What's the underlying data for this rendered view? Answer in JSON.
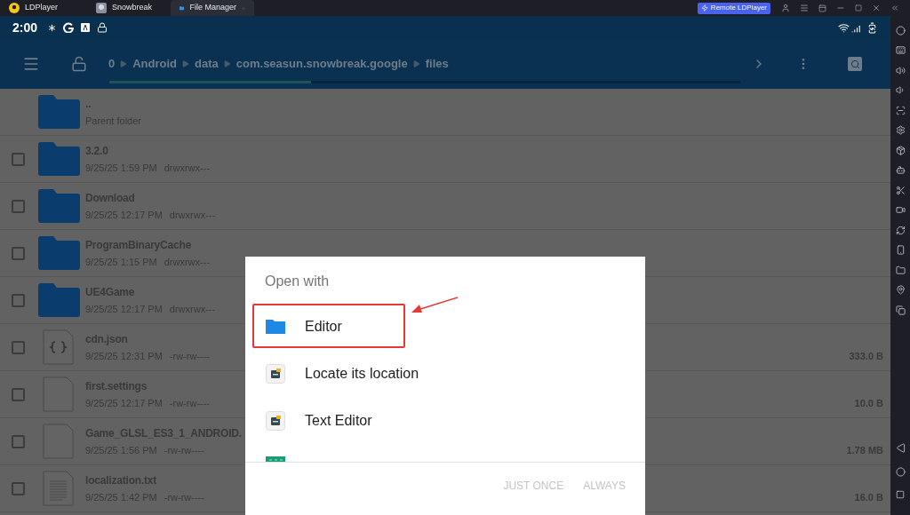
{
  "tabs": [
    {
      "label": "LDPlayer",
      "kind": "logo",
      "selected": false
    },
    {
      "label": "Snowbreak",
      "kind": "game",
      "selected": false
    },
    {
      "label": "File Manager",
      "kind": "folder",
      "selected": true
    }
  ],
  "remote_button": "Remote LDPlayer",
  "status_bar": {
    "time": "2:00"
  },
  "breadcrumbs": [
    "0",
    "Android",
    "data",
    "com.seasun.snowbreak.google",
    "files"
  ],
  "path_scroll": {
    "level": 0.32
  },
  "files": [
    {
      "kind": "parent",
      "name": "..",
      "meta": "Parent folder"
    },
    {
      "kind": "folder",
      "name": "3.2.0",
      "date": "9/25/25 1:59 PM",
      "perms": "drwxrwx---",
      "checked": false
    },
    {
      "kind": "folder",
      "name": "Download",
      "date": "9/25/25 12:17 PM",
      "perms": "drwxrwx---",
      "checked": false
    },
    {
      "kind": "folder",
      "name": "ProgramBinaryCache",
      "date": "9/25/25 1:15 PM",
      "perms": "drwxrwx---",
      "checked": false
    },
    {
      "kind": "folder",
      "name": "UE4Game",
      "date": "9/25/25 12:17 PM",
      "perms": "drwxrwx---",
      "checked": false
    },
    {
      "kind": "json",
      "name": "cdn.json",
      "date": "9/25/25 12:31 PM",
      "perms": "-rw-rw----",
      "size": "333.0 B",
      "checked": false
    },
    {
      "kind": "file",
      "name": "first.settings",
      "date": "9/25/25 12:17 PM",
      "perms": "-rw-rw----",
      "size": "10.0 B",
      "checked": false
    },
    {
      "kind": "file",
      "name": "Game_GLSL_ES3_1_ANDROID.",
      "date": "9/25/25 1:56 PM",
      "perms": "-rw-rw----",
      "size": "1.78 MB",
      "checked": false
    },
    {
      "kind": "text",
      "name": "localization.txt",
      "date": "9/25/25 1:42 PM",
      "perms": "-rw-rw----",
      "size": "16.0 B",
      "checked": false
    }
  ],
  "dialog": {
    "title": "Open with",
    "options": [
      {
        "kind": "folder",
        "label": "Editor",
        "highlighted": true
      },
      {
        "kind": "app",
        "label": "Locate its location",
        "highlighted": false
      },
      {
        "kind": "app",
        "label": "Text Editor",
        "highlighted": false
      },
      {
        "kind": "viewer",
        "highlighted": false
      }
    ],
    "buttons": [
      {
        "label": "JUST ONCE",
        "disabled": true
      },
      {
        "label": "ALWAYS",
        "disabled": true
      }
    ]
  }
}
